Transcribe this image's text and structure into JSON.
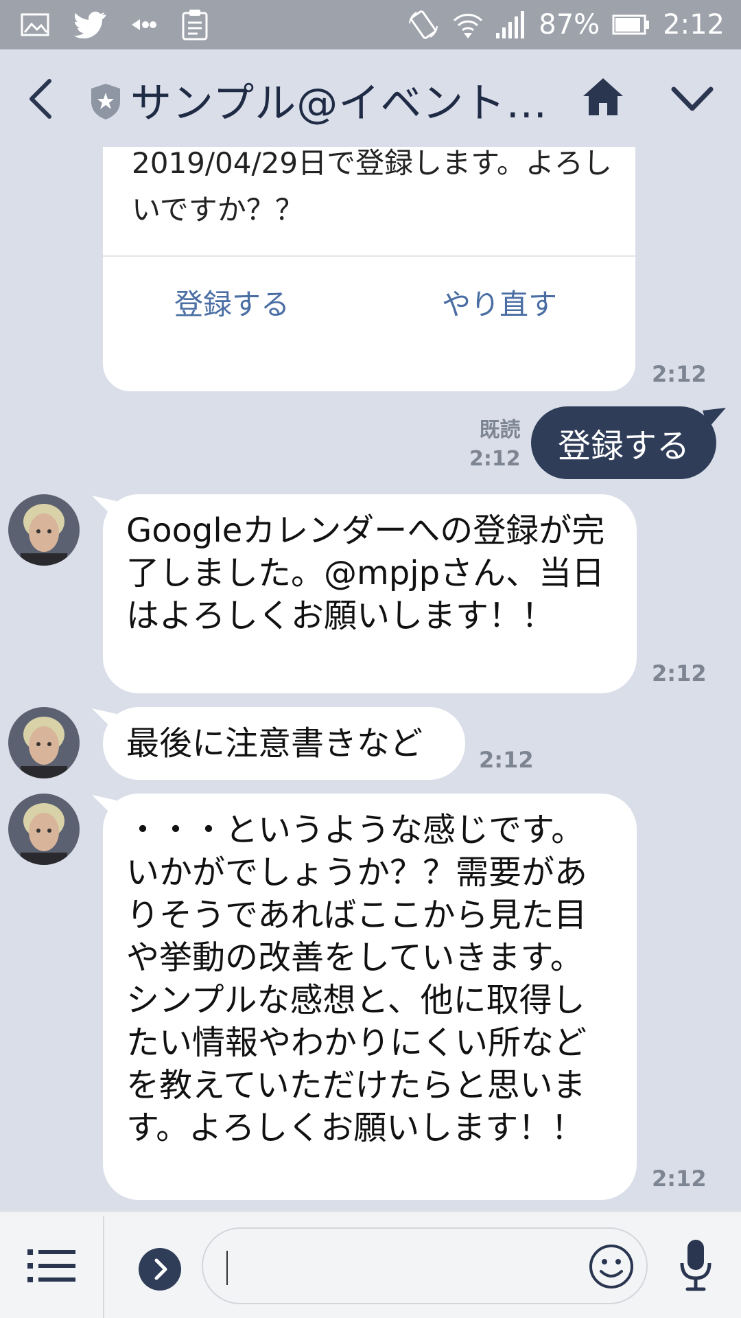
{
  "statusbar": {
    "battery_pct": "87%",
    "time": "2:12",
    "icons": [
      "gallery-icon",
      "twitter-icon",
      "remote-icon",
      "clipboard-icon",
      "rotation-icon",
      "wifi-icon",
      "signal-icon",
      "battery-icon"
    ]
  },
  "header": {
    "title": "サンプル@イベント…",
    "icons": [
      "back-icon",
      "shield-icon",
      "home-icon",
      "chevron-down-icon"
    ]
  },
  "messages": {
    "confirm_card": {
      "text": "2019/04/29日で登録します。よろしいですか？？",
      "button_register": "登録する",
      "button_redo": "やり直す",
      "time": "2:12"
    },
    "sent": {
      "read_label": "既読",
      "time": "2:12",
      "text": "登録する"
    },
    "reply1": {
      "text": "Googleカレンダーへの登録が完了しました。@mpjpさん、当日はよろしくお願いします！！",
      "time": "2:12"
    },
    "reply2": {
      "text": "最後に注意書きなど",
      "time": "2:12"
    },
    "reply3": {
      "text": "・・・というような感じです。いかがでしょうか？？需要がありそうであればここから見た目や挙動の改善をしていきます。シンプルな感想と、他に取得したい情報やわかりにくい所などを教えていただけたらと思います。よろしくお願いします！！",
      "time": "2:12"
    }
  },
  "inputbar": {
    "input_value": "",
    "icons": [
      "menu-icon",
      "expand-arrow-icon",
      "emoji-icon",
      "microphone-icon"
    ]
  },
  "colors": {
    "chat_bg": "#d9dee9",
    "my_bubble": "#2f3d59",
    "link_blue": "#4a6ea3",
    "status_bar": "#9ea2ab"
  }
}
